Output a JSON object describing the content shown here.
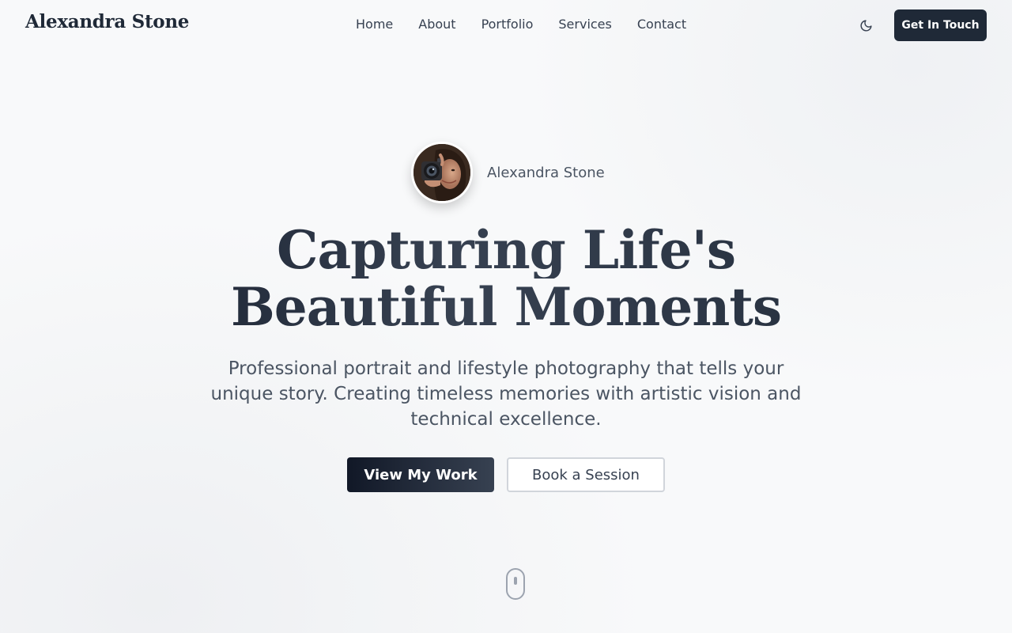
{
  "header": {
    "brand": "Alexandra Stone",
    "nav": [
      {
        "label": "Home"
      },
      {
        "label": "About"
      },
      {
        "label": "Portfolio"
      },
      {
        "label": "Services"
      },
      {
        "label": "Contact"
      }
    ],
    "theme_toggle_icon": "moon-icon",
    "cta_label": "Get In Touch"
  },
  "hero": {
    "avatar_icon": "photographer-portrait",
    "profile_name": "Alexandra Stone",
    "headline_line1": "Capturing Life's",
    "headline_line2": "Beautiful Moments",
    "subtitle": "Professional portrait and lifestyle photography that tells your unique story. Creating timeless memories with artistic vision and technical excellence.",
    "primary_button": "View My Work",
    "secondary_button": "Book a Session",
    "scroll_icon": "mouse-scroll-icon"
  },
  "colors": {
    "background": "#f8f9fa",
    "primary_dark": "#1f2937",
    "text_muted": "#4b5563",
    "border": "#d1d5db"
  }
}
